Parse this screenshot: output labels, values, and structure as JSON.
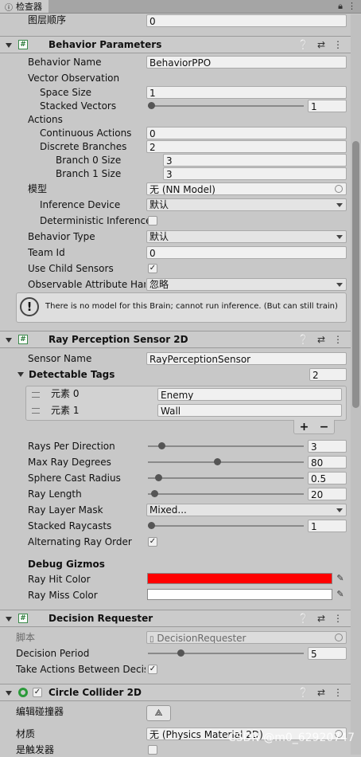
{
  "window": {
    "tab_title": "检查器",
    "tab_icon": "info-icon",
    "lock_icon": "lock-icon",
    "menu_icon": "kebab-icon"
  },
  "top": {
    "layer_order_label": "图层顺序",
    "layer_order_value": "0"
  },
  "behavior_parameters": {
    "title": "Behavior Parameters",
    "behavior_name_label": "Behavior Name",
    "behavior_name_value": "BehaviorPPO",
    "vector_observation_label": "Vector Observation",
    "space_size_label": "Space Size",
    "space_size_value": "1",
    "stacked_vectors_label": "Stacked Vectors",
    "stacked_vectors_value": "1",
    "stacked_vectors_fraction": 0.0,
    "actions_label": "Actions",
    "continuous_actions_label": "Continuous Actions",
    "continuous_actions_value": "0",
    "discrete_branches_label": "Discrete Branches",
    "discrete_branches_value": "2",
    "branch0_label": "Branch 0 Size",
    "branch0_value": "3",
    "branch1_label": "Branch 1 Size",
    "branch1_value": "3",
    "model_label": "模型",
    "model_value": "无 (NN Model)",
    "inference_device_label": "Inference Device",
    "inference_device_value": "默认",
    "deterministic_label": "Deterministic Inference",
    "deterministic_checked": false,
    "behavior_type_label": "Behavior Type",
    "behavior_type_value": "默认",
    "team_id_label": "Team Id",
    "team_id_value": "0",
    "use_child_sensors_label": "Use Child Sensors",
    "use_child_sensors_checked": true,
    "observable_label": "Observable Attribute Han",
    "observable_value": "忽略",
    "help_text": "There is no model for this Brain; cannot run inference. (But can still train)"
  },
  "ray_sensor": {
    "title": "Ray Perception Sensor 2D",
    "sensor_name_label": "Sensor Name",
    "sensor_name_value": "RayPerceptionSensor",
    "detectable_tags_label": "Detectable Tags",
    "detectable_tags_count": "2",
    "tags": [
      {
        "label": "元素 0",
        "value": "Enemy"
      },
      {
        "label": "元素 1",
        "value": "Wall"
      }
    ],
    "plus_label": "+",
    "minus_label": "−",
    "rays_per_direction_label": "Rays Per Direction",
    "rays_per_direction_value": "3",
    "rays_per_direction_fraction": 0.07,
    "max_ray_degrees_label": "Max Ray Degrees",
    "max_ray_degrees_value": "80",
    "max_ray_degrees_fraction": 0.444,
    "sphere_cast_radius_label": "Sphere Cast Radius",
    "sphere_cast_radius_value": "0.5",
    "sphere_cast_radius_fraction": 0.05,
    "ray_length_label": "Ray Length",
    "ray_length_value": "20",
    "ray_length_fraction": 0.02,
    "ray_layer_mask_label": "Ray Layer Mask",
    "ray_layer_mask_value": "Mixed...",
    "stacked_raycasts_label": "Stacked Raycasts",
    "stacked_raycasts_value": "1",
    "stacked_raycasts_fraction": 0.0,
    "alternating_label": "Alternating Ray Order",
    "alternating_checked": true,
    "debug_gizmos_label": "Debug Gizmos",
    "ray_hit_color_label": "Ray Hit Color",
    "ray_hit_color": "#ff0000",
    "ray_miss_color_label": "Ray Miss Color",
    "ray_miss_color": "#ffffff"
  },
  "decision_requester": {
    "title": "Decision Requester",
    "script_label": "脚本",
    "script_value": "DecisionRequester",
    "decision_period_label": "Decision Period",
    "decision_period_value": "5",
    "decision_period_fraction": 0.2,
    "take_actions_label": "Take Actions Between Decis",
    "take_actions_checked": true
  },
  "circle_collider": {
    "title": "Circle Collider 2D",
    "enabled": true,
    "edit_collider_label": "编辑碰撞器",
    "material_label": "材质",
    "material_value": "无 (Physics Material 2D)",
    "is_trigger_label": "是触发器",
    "is_trigger_checked": false
  },
  "watermark": "CSDN @m0_62920747",
  "colors": {
    "accent_green": "#2b7a3a",
    "panel": "#c8c8c8"
  }
}
